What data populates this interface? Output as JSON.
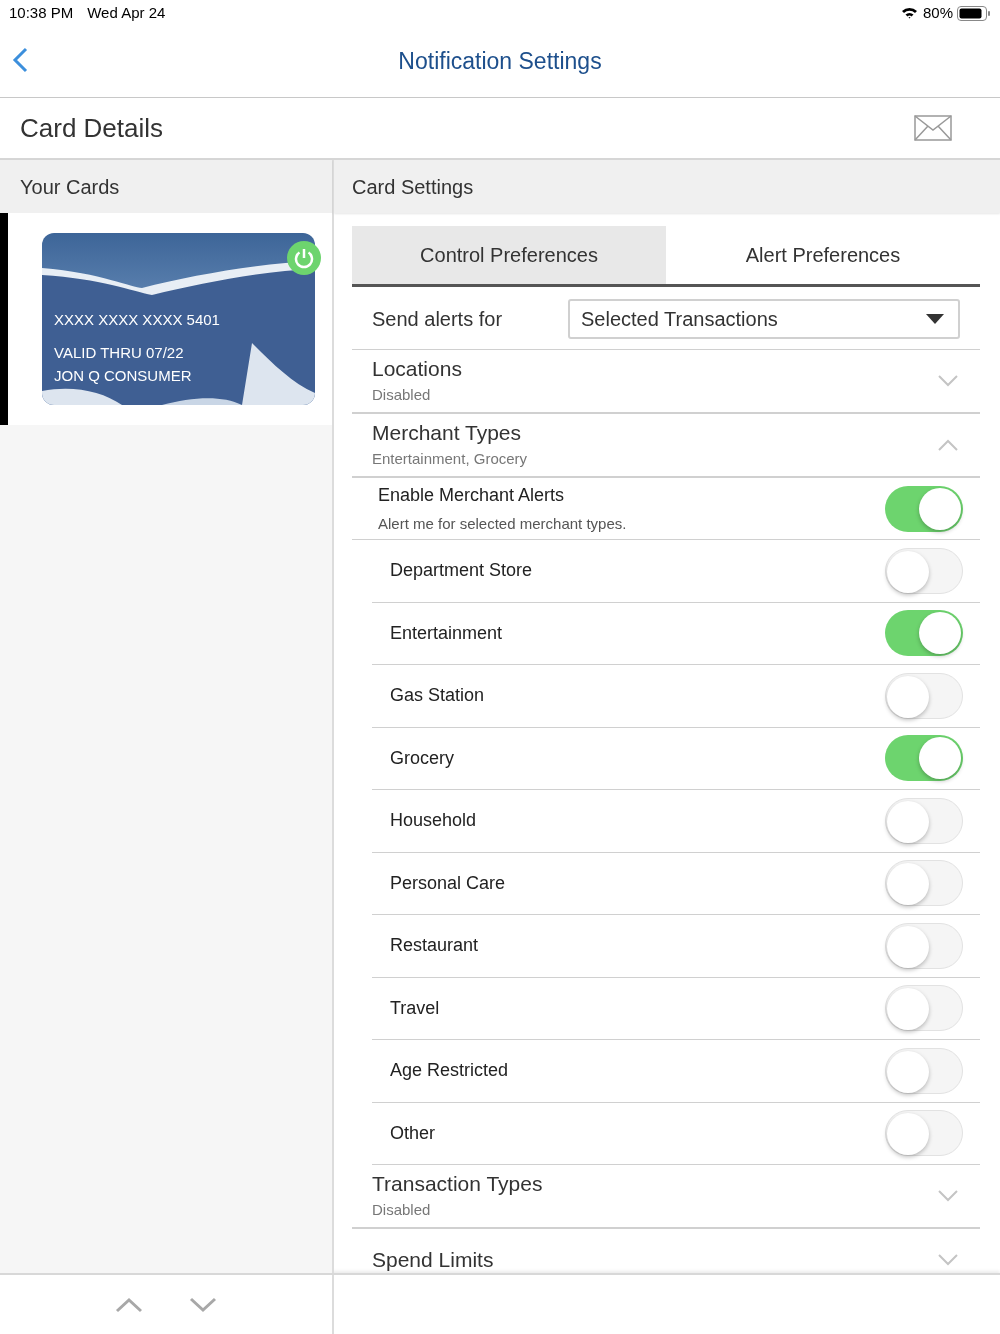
{
  "status_bar": {
    "time": "10:38 PM",
    "date": "Wed Apr 24",
    "battery": "80%"
  },
  "nav": {
    "title": "Notification Settings"
  },
  "header": {
    "title": "Card Details"
  },
  "cards_panel": {
    "title": "Your Cards",
    "cards": [
      {
        "number": "XXXX XXXX XXXX 5401",
        "valid": "VALID THRU 07/22",
        "name": "JON Q CONSUMER",
        "active": true,
        "selected": true
      }
    ]
  },
  "settings_panel": {
    "title": "Card Settings",
    "tabs": [
      {
        "label": "Control Preferences",
        "selected": false
      },
      {
        "label": "Alert Preferences",
        "selected": true
      }
    ],
    "send_alerts": {
      "label": "Send alerts for",
      "value": "Selected Transactions"
    },
    "sections": [
      {
        "title": "Locations",
        "subtitle": "Disabled",
        "expanded": false
      },
      {
        "title": "Merchant Types",
        "subtitle": "Entertainment, Grocery",
        "expanded": true,
        "master": {
          "title": "Enable Merchant Alerts",
          "subtitle": "Alert me for selected merchant types.",
          "on": true
        },
        "items": [
          {
            "label": "Department Store",
            "on": false
          },
          {
            "label": "Entertainment",
            "on": true
          },
          {
            "label": "Gas Station",
            "on": false
          },
          {
            "label": "Grocery",
            "on": true
          },
          {
            "label": "Household",
            "on": false
          },
          {
            "label": "Personal Care",
            "on": false
          },
          {
            "label": "Restaurant",
            "on": false
          },
          {
            "label": "Travel",
            "on": false
          },
          {
            "label": "Age Restricted",
            "on": false
          },
          {
            "label": "Other",
            "on": false
          }
        ]
      },
      {
        "title": "Transaction Types",
        "subtitle": "Disabled",
        "expanded": false
      },
      {
        "title": "Spend Limits",
        "expanded": false
      }
    ]
  }
}
